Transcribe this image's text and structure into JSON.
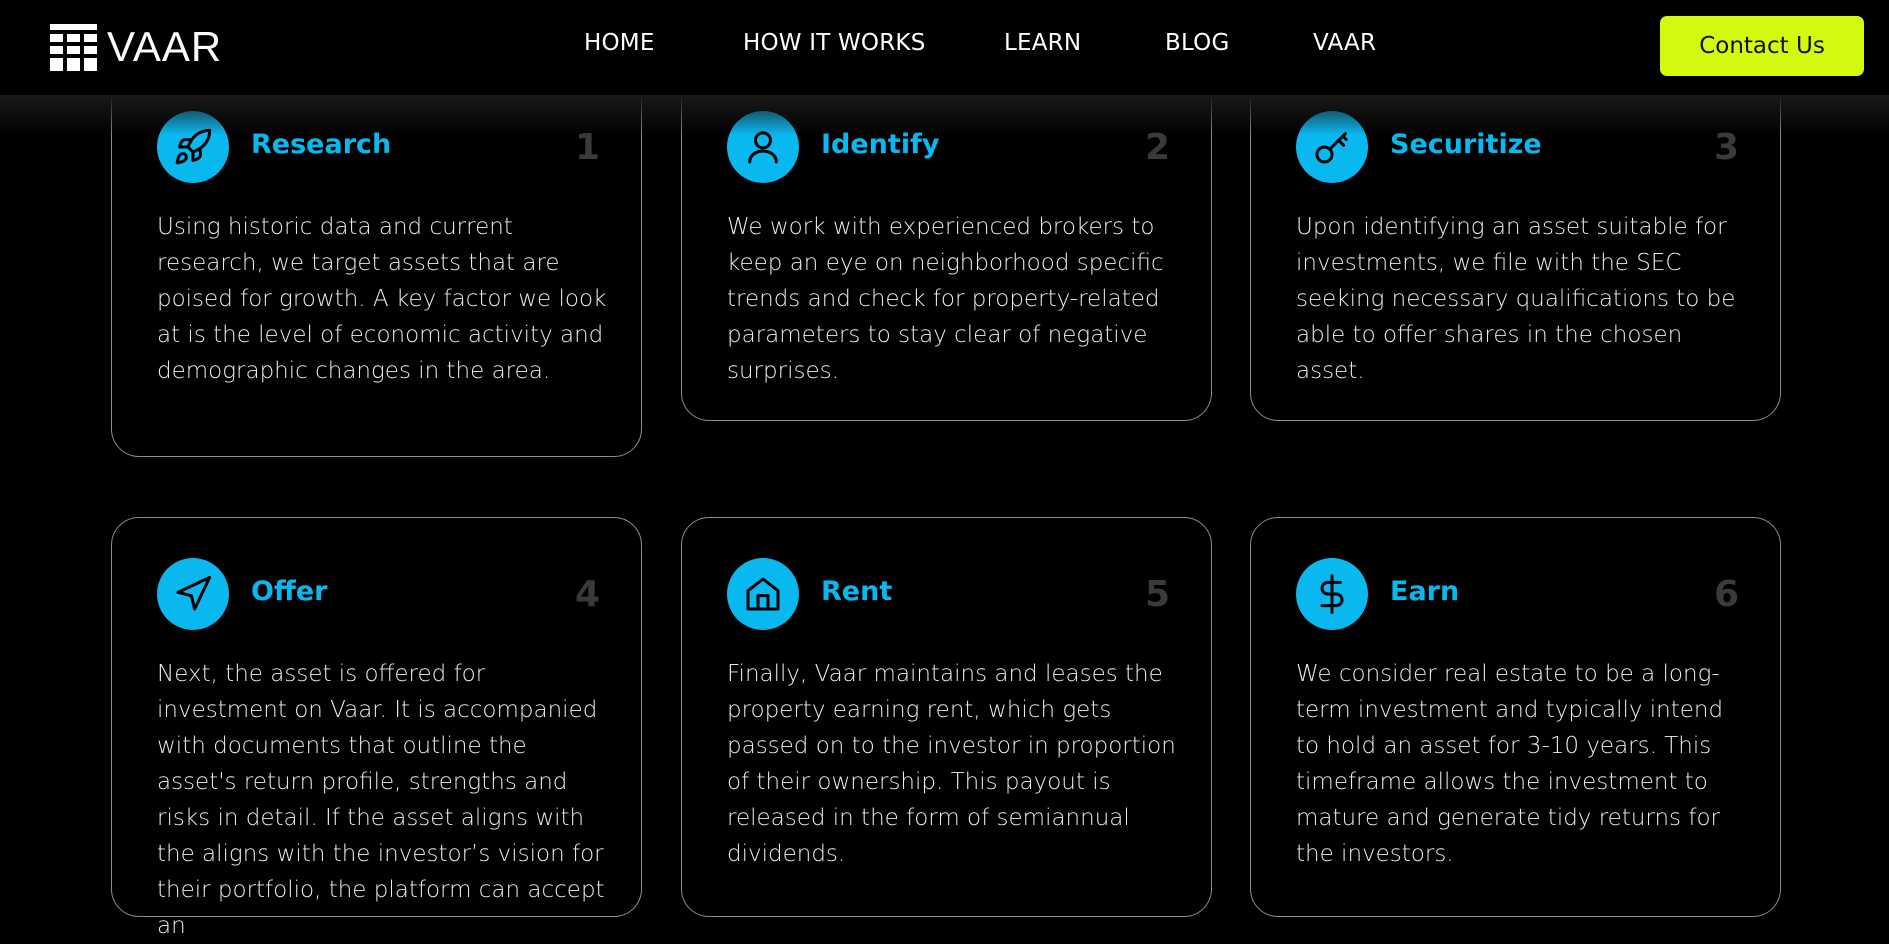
{
  "header": {
    "logo_text": "VAAR",
    "nav": [
      "HOME",
      "HOW IT WORKS",
      "LEARN",
      "BLOG",
      "VAAR"
    ],
    "contact_label": "Contact Us",
    "accent_color": "#d4f80e"
  },
  "steps": [
    {
      "title": "Research",
      "number": "1",
      "icon": "rocket-icon",
      "body": "Using historic data and current research, we target assets that are poised for growth. A key factor we look at is the level of economic activity and demographic changes in the area."
    },
    {
      "title": "Identify",
      "number": "2",
      "icon": "user-icon",
      "body": "We work with experienced brokers to keep an eye on neighborhood specific trends and check for property-related parameters to stay clear of negative surprises."
    },
    {
      "title": "Securitize",
      "number": "3",
      "icon": "key-icon",
      "body": "Upon identifying an asset suitable for investments, we file with the SEC seeking necessary qualifications to be able to offer shares in the chosen asset."
    },
    {
      "title": "Offer",
      "number": "4",
      "icon": "navigation-arrow-icon",
      "body": "Next, the asset is offered for investment on Vaar. It is accompanied with documents that outline the asset's return profile, strengths and risks in detail. If the asset aligns with the aligns with the investor’s vision for their portfolio, the platform can accept an"
    },
    {
      "title": "Rent",
      "number": "5",
      "icon": "house-icon",
      "body": "Finally, Vaar maintains and leases the property earning rent, which gets passed on to the investor in proportion of their ownership. This payout is released in the form of semiannual dividends."
    },
    {
      "title": "Earn",
      "number": "6",
      "icon": "dollar-icon",
      "body": "We consider real estate to be a long-term investment and typically intend to hold an asset for 3-10 years. This timeframe allows the investment to mature and generate tidy returns for the investors."
    }
  ],
  "colors": {
    "icon_bg": "#0ab8f0",
    "title": "#0ab8f0",
    "number": "#3a3a3a",
    "background": "#000000"
  }
}
